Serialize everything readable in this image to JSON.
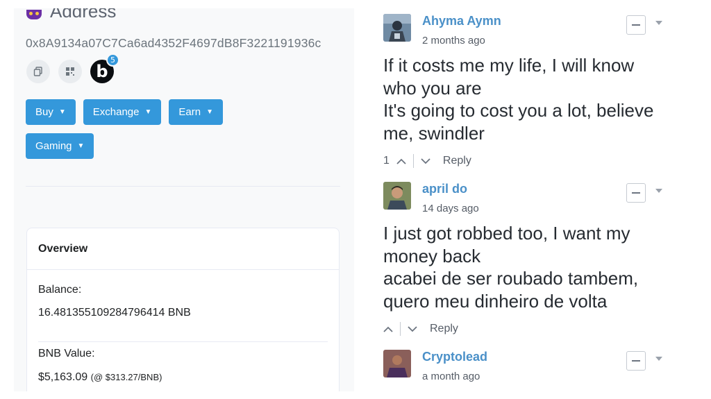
{
  "address": {
    "title": "Address",
    "hash": "0x8A9134a07C7Ca6ad4352F4697dB8F3221191936c",
    "badge_letter": "b",
    "badge_count": "5"
  },
  "actions": {
    "buy": "Buy",
    "exchange": "Exchange",
    "earn": "Earn",
    "gaming": "Gaming"
  },
  "overview": {
    "title": "Overview",
    "balance_label": "Balance:",
    "balance_value": "16.481355109284796414 BNB",
    "bnb_value_label": "BNB Value:",
    "bnb_value": "$5,163.09",
    "bnb_rate": "(@ $313.27/BNB)"
  },
  "comments": [
    {
      "author": "Ahyma Aymn",
      "time": "2 months ago",
      "lines": [
        "If it costs me my life, I will know",
        "who you are",
        "It's going to cost you a lot, believe",
        "me, swindler"
      ],
      "votes": "1",
      "reply": "Reply"
    },
    {
      "author": "april do",
      "time": "14 days ago",
      "lines": [
        "I just got robbed too, I want my",
        "money back",
        "acabei de ser roubado tambem,",
        "quero meu dinheiro de volta"
      ],
      "votes": "",
      "reply": "Reply"
    },
    {
      "author": "Cryptolead",
      "time": "a month ago"
    }
  ],
  "colors": {
    "primary": "#3498db",
    "author": "#4a90c8",
    "badge_bg": "#0b0e11"
  }
}
